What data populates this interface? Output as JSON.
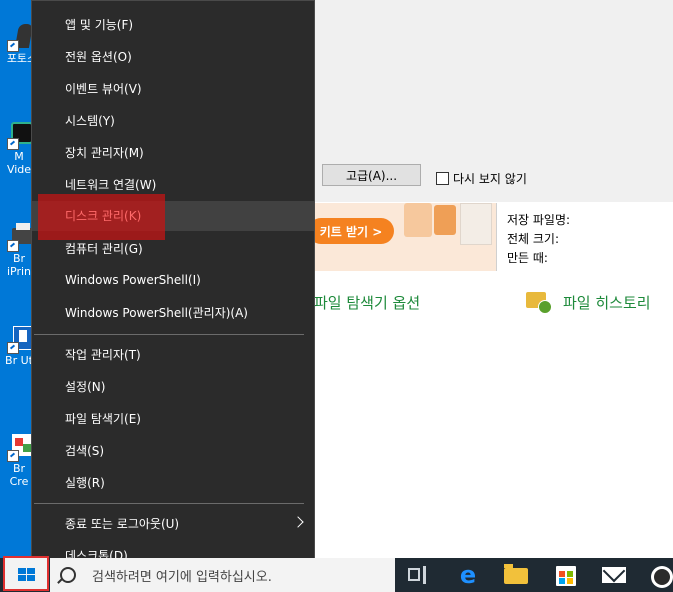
{
  "desktop": {
    "icons": [
      {
        "label": "포토스"
      },
      {
        "label": "M Vide"
      },
      {
        "label": "Br iPrin"
      },
      {
        "label": "Br Ut"
      },
      {
        "label": "Br Cre"
      }
    ]
  },
  "background_window": {
    "advanced_button": "고급(A)...",
    "dont_show_again": "다시 보지 않기",
    "banner_button": "키트 받기 >",
    "info_lines": [
      "저장 파일명:",
      "전체 크기:",
      "만든 때:"
    ],
    "explorer_options_link": "파일 탐색기 옵션",
    "file_history_link": "파일 히스토리"
  },
  "context_menu": {
    "items": [
      {
        "label": "앱 및 기능(F)"
      },
      {
        "label": "전원 옵션(O)"
      },
      {
        "label": "이벤트 뷰어(V)"
      },
      {
        "label": "시스템(Y)"
      },
      {
        "label": "장치 관리자(M)"
      },
      {
        "label": "네트워크 연결(W)"
      },
      {
        "label": "디스크 관리(K)"
      },
      {
        "label": "컴퓨터 관리(G)"
      },
      {
        "label": "Windows PowerShell(I)"
      },
      {
        "label": "Windows PowerShell(관리자)(A)"
      },
      {
        "label": "작업 관리자(T)"
      },
      {
        "label": "설정(N)"
      },
      {
        "label": "파일 탐색기(E)"
      },
      {
        "label": "검색(S)"
      },
      {
        "label": "실행(R)"
      },
      {
        "label": "종료 또는 로그아웃(U)"
      },
      {
        "label": "데스크톱(D)"
      }
    ],
    "highlighted_item": "디스크 관리(K)"
  },
  "taskbar": {
    "search_placeholder": "검색하려면 여기에 입력하십시오."
  },
  "colors": {
    "desktop": "#0078d7",
    "menu_bg": "#2b2b2b",
    "highlight": "#c81414",
    "taskbar": "#1f2a33"
  }
}
